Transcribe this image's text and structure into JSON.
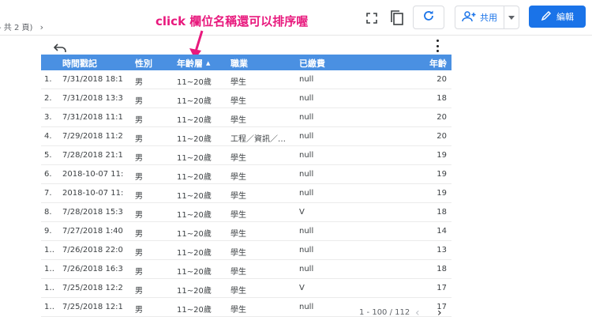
{
  "header": {
    "page_info": "共 2 頁",
    "page_info_prefix": "-",
    "page_info_suffix": ")",
    "annotation": "click 欄位名稱還可以排序喔",
    "share_label": "共用",
    "edit_label": "編輯"
  },
  "table": {
    "columns": [
      "時間戳記",
      "性別",
      "年齡層",
      "職業",
      "已繳費",
      "年齡"
    ],
    "sorted_column": "年齡層",
    "rows": [
      [
        "1.",
        "7/31/2018 18:1…",
        "男",
        "11~20歲",
        "學生",
        "null",
        "20"
      ],
      [
        "2.",
        "7/31/2018 13:3…",
        "男",
        "11~20歲",
        "學生",
        "null",
        "18"
      ],
      [
        "3.",
        "7/31/2018 11:1…",
        "男",
        "11~20歲",
        "學生",
        "null",
        "20"
      ],
      [
        "4.",
        "7/29/2018 11:2…",
        "男",
        "11~20歲",
        "工程／資訊／研…",
        "null",
        "20"
      ],
      [
        "5.",
        "7/28/2018 21:1…",
        "男",
        "11~20歲",
        "學生",
        "null",
        "19"
      ],
      [
        "6.",
        "2018-10-07 11:1…",
        "男",
        "11~20歲",
        "學生",
        "null",
        "19"
      ],
      [
        "7.",
        "2018-10-07 11:2…",
        "男",
        "11~20歲",
        "學生",
        "null",
        "19"
      ],
      [
        "8.",
        "7/28/2018 15:3…",
        "男",
        "11~20歲",
        "學生",
        "V",
        "18"
      ],
      [
        "9.",
        "7/27/2018 1:40:…",
        "男",
        "11~20歲",
        "學生",
        "null",
        "14"
      ],
      [
        "1…",
        "7/26/2018 22:0…",
        "男",
        "11~20歲",
        "學生",
        "null",
        "13"
      ],
      [
        "1…",
        "7/26/2018 16:3…",
        "男",
        "11~20歲",
        "學生",
        "null",
        "18"
      ],
      [
        "1…",
        "7/25/2018 12:2…",
        "男",
        "11~20歲",
        "學生",
        "V",
        "17"
      ],
      [
        "1…",
        "7/25/2018 12:1…",
        "男",
        "11~20歲",
        "學生",
        "null",
        "17"
      ]
    ],
    "pagination": "1 - 100 / 112"
  },
  "colors": {
    "accent": "#1a73e8",
    "header_bg": "#4a90e2",
    "annotation": "#e8197d"
  },
  "icons": [
    "fullscreen-icon",
    "copy-icon",
    "refresh-icon",
    "add-person-icon",
    "caret-down-icon",
    "pencil-icon",
    "undo-icon",
    "more-vert-icon",
    "chevron-left-icon",
    "chevron-right-icon",
    "chevron-right-small-icon"
  ]
}
